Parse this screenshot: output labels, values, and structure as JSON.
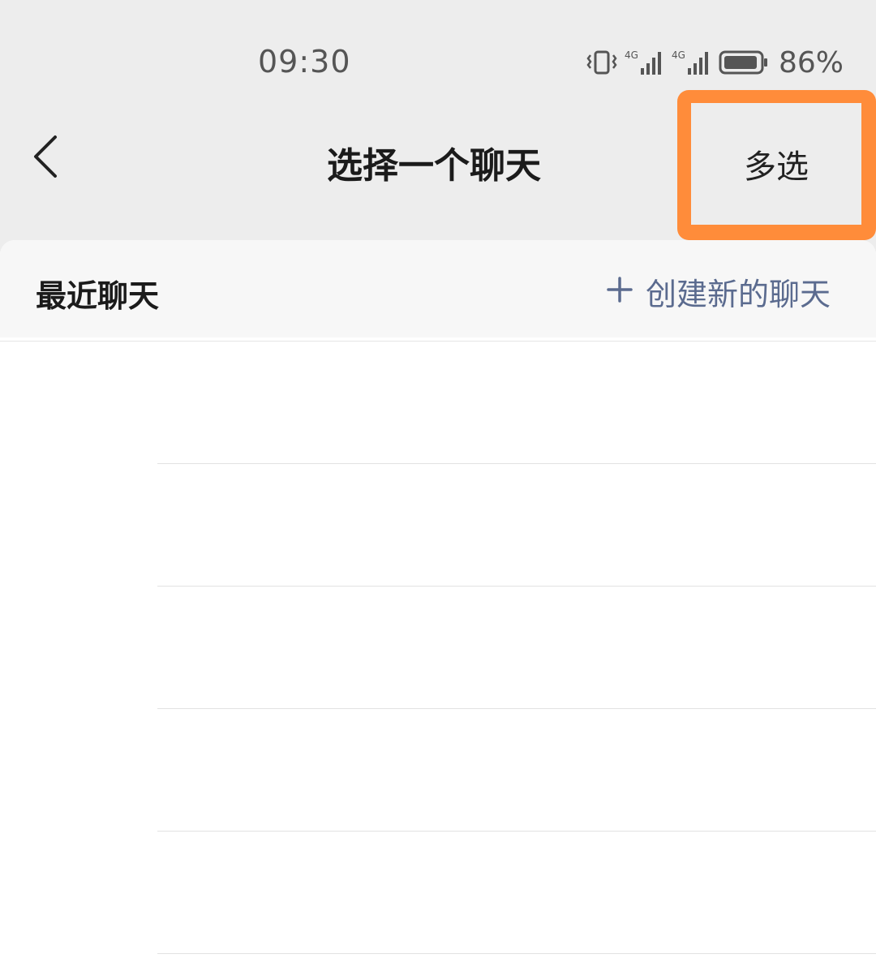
{
  "status_bar": {
    "time": "09:30",
    "battery": "86%",
    "network_1": "4G",
    "network_2": "4G"
  },
  "header": {
    "title": "选择一个聊天",
    "multi_select_label": "多选",
    "highlight_color": "#ff8c3a"
  },
  "section": {
    "title": "最近聊天",
    "create_label": "创建新的聊天",
    "accent_color": "#5b6b8f"
  },
  "chat_list": {
    "items": [
      {
        "name": ""
      },
      {
        "name": ""
      },
      {
        "name": ""
      },
      {
        "name": ""
      },
      {
        "name": ""
      }
    ]
  },
  "icons": {
    "back": "chevron-left-icon",
    "vibrate": "vibrate-icon",
    "signal": "signal-icon",
    "battery": "battery-icon",
    "plus": "plus-icon"
  }
}
